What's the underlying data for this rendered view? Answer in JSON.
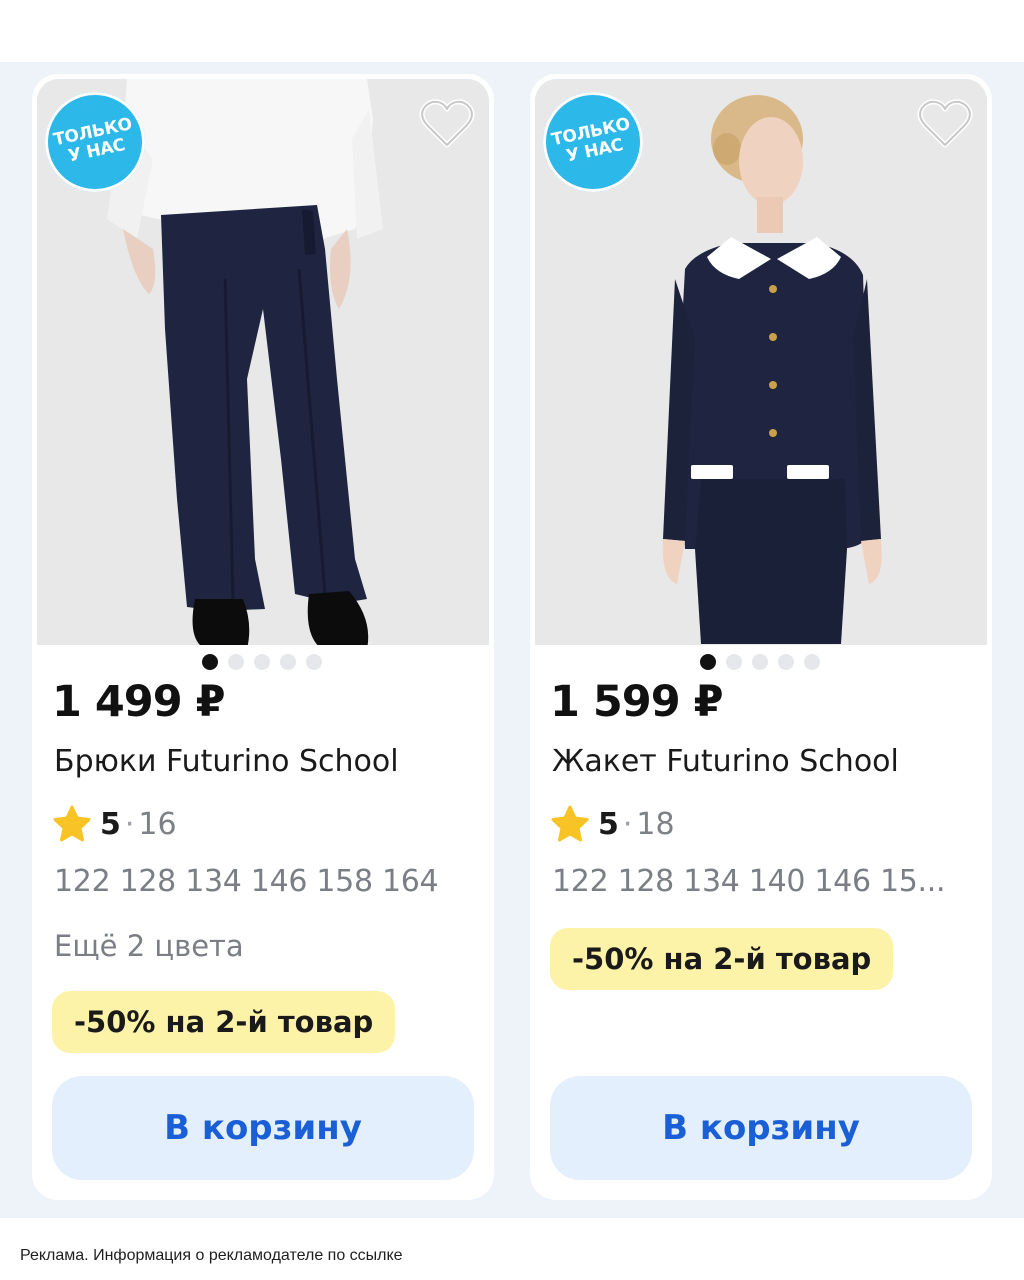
{
  "products": [
    {
      "badge": "ТОЛЬКО\nУ НАС",
      "price": "1 499 ₽",
      "title": "Брюки Futurino School",
      "rating": "5",
      "reviews": "16",
      "sizes": "122 128 134 146 158 164",
      "colors_note": "Ещё 2 цвета",
      "promo": "-50% на 2-й товар",
      "cart_label": "В корзину",
      "photo_index": 1,
      "photo_count": 5
    },
    {
      "badge": "ТОЛЬКО\nУ НАС",
      "price": "1 599 ₽",
      "title": "Жакет Futurino School",
      "rating": "5",
      "reviews": "18",
      "sizes": "122 128 134 140 146 15...",
      "promo": "-50% на 2-й товар",
      "cart_label": "В корзину",
      "photo_index": 1,
      "photo_count": 5
    }
  ],
  "footer": {
    "ad_note": "Реклама. Информация о рекламодателе по ссылке"
  },
  "colors": {
    "badge": "#2db8ea",
    "promo_bg": "#fdf3a8",
    "button_bg": "#e4effd",
    "button_text": "#1a5fd6",
    "star": "#f7c325"
  },
  "icons": [
    "heart-icon",
    "star-icon"
  ]
}
